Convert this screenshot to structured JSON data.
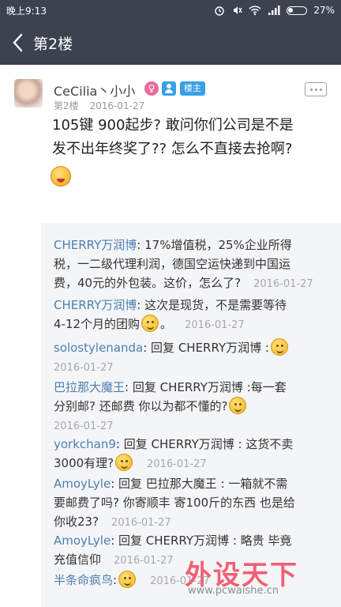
{
  "status_bar": {
    "time": "晚上9:13",
    "battery": "27%"
  },
  "nav": {
    "title": "第2楼"
  },
  "post": {
    "username": "CeCilia丶小小",
    "gender_badge": "♀",
    "host_badge": "楼主",
    "floor": "第2楼",
    "date": "2016-01-27",
    "content_line1": "105键 900起步? 敢问你们公司是不是",
    "content_line2": "发不出年终奖了?? 怎么不直接去抢啊?"
  },
  "comments": [
    {
      "user": "CHERRY万润博",
      "line1": ": 17%增值税，25%企业所得",
      "line2": "税，一二级代理利润，德国空运快递到中国运",
      "line3": "费，40元的外包装。这价，怎么了?",
      "date": "2016-01-27"
    },
    {
      "user": "CHERRY万润博",
      "line1": ": 这次是现货，不是需要等待",
      "line2": "4-12个月的团购",
      "line2b": "。",
      "date": "2016-01-27"
    },
    {
      "user": "solostylenanda",
      "line1": ": 回复 CHERRY万润博 :",
      "date": "2016-01-27"
    },
    {
      "user": "巴拉那大魔王",
      "line1": ": 回复 CHERRY万润博 :每一套",
      "line2": "分别邮? 还邮费 你以为都不懂的?",
      "date": "2016-01-27"
    },
    {
      "user": "yorkchan9",
      "line1": ": 回复 CHERRY万润博 : 这货不卖",
      "line2": "3000有理?",
      "date": "2016-01-27"
    },
    {
      "user": "AmoyLyle",
      "line1": ": 回复 巴拉那大魔王 : 一箱就不需",
      "line2": "要邮费了吗? 你寄顺丰 寄100斤的东西 也是给",
      "line3": "你收23?",
      "date": "2016-01-27"
    },
    {
      "user": "AmoyLyle",
      "line1": ": 回复 CHERRY万润博 : 略贵 毕竟",
      "line2": "充值信仰",
      "date": "2016-01-27"
    },
    {
      "user": "半条命疯鸟",
      "line1": ":",
      "date": "2016-01-27"
    }
  ],
  "watermark": {
    "logo": "外设天下",
    "url": "www.pcwaishe.cn"
  },
  "colors": {
    "header_bg": "#3d4251",
    "comment_bg": "#f4f5f7",
    "username_blue": "#4d7fb0",
    "host_badge": "#3aa0e6",
    "gender_pink": "#e86b9c"
  }
}
